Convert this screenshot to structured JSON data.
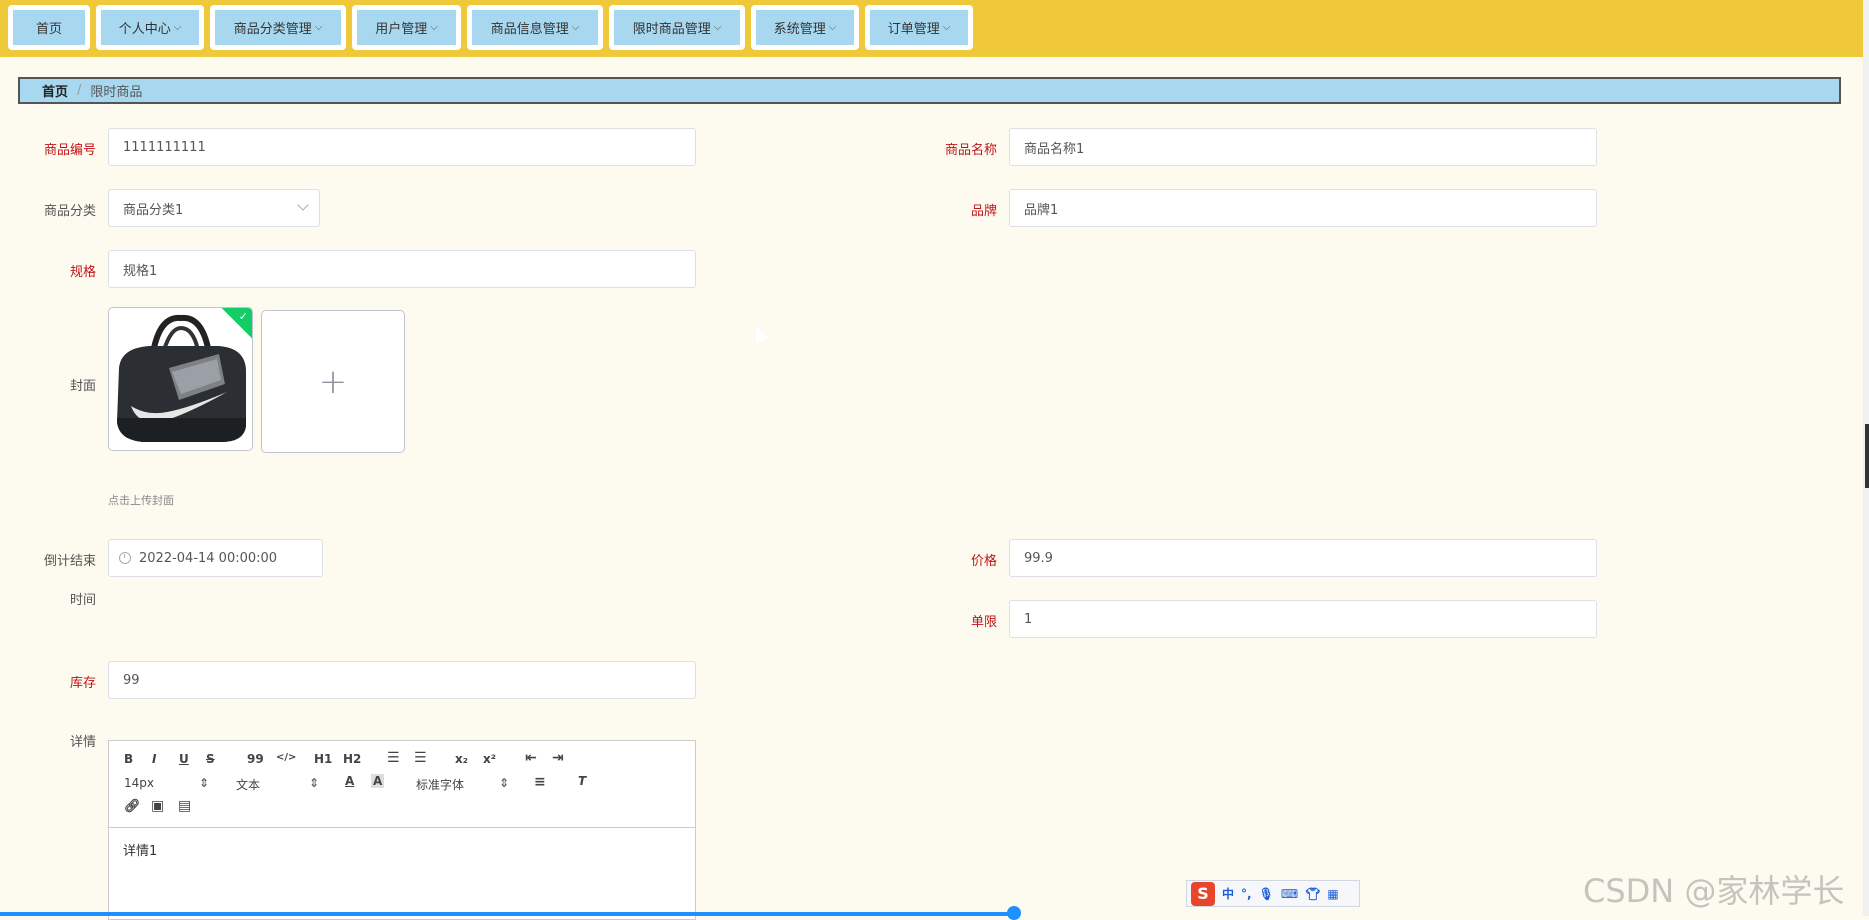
{
  "nav": [
    {
      "label": "首页",
      "has_dropdown": false
    },
    {
      "label": "个人中心",
      "has_dropdown": true
    },
    {
      "label": "商品分类管理",
      "has_dropdown": true
    },
    {
      "label": "用户管理",
      "has_dropdown": true
    },
    {
      "label": "商品信息管理",
      "has_dropdown": true
    },
    {
      "label": "限时商品管理",
      "has_dropdown": true
    },
    {
      "label": "系统管理",
      "has_dropdown": true
    },
    {
      "label": "订单管理",
      "has_dropdown": true
    }
  ],
  "breadcrumb": {
    "home": "首页",
    "separator": "/",
    "current": "限时商品"
  },
  "form": {
    "product_code": {
      "label": "商品编号",
      "value": "1111111111"
    },
    "product_name": {
      "label": "商品名称",
      "value": "商品名称1"
    },
    "category": {
      "label": "商品分类",
      "value": "商品分类1"
    },
    "brand": {
      "label": "品牌",
      "value": "品牌1"
    },
    "spec": {
      "label": "规格",
      "value": "规格1"
    },
    "cover": {
      "label": "封面",
      "hint": "点击上传封面",
      "upload_icon": "+"
    },
    "countdown_end": {
      "label_line1": "倒计结束",
      "label_line2": "时间",
      "value": "2022-04-14 00:00:00"
    },
    "price": {
      "label": "价格",
      "value": "99.9"
    },
    "limit": {
      "label": "单限",
      "value": "1"
    },
    "stock": {
      "label": "库存",
      "value": "99"
    },
    "details": {
      "label": "详情",
      "value": "详情1"
    }
  },
  "editor_toolbar": {
    "bold": "B",
    "italic": "I",
    "underline": "U",
    "strike": "S",
    "quote": "99",
    "code": "</>",
    "h1": "H1",
    "h2": "H2",
    "sub": "x₂",
    "sup": "x²",
    "size": "14px",
    "header": "文本",
    "font": "标准字体"
  },
  "ime": {
    "logo": "S",
    "mode": "中"
  },
  "watermark": "CSDN @家林学长",
  "colors": {
    "topbar": "#f0c93b",
    "nav_tab": "#a8d8f0",
    "required_label": "#c0141b",
    "success": "#13ce66",
    "page_bg": "#fdfbef"
  }
}
